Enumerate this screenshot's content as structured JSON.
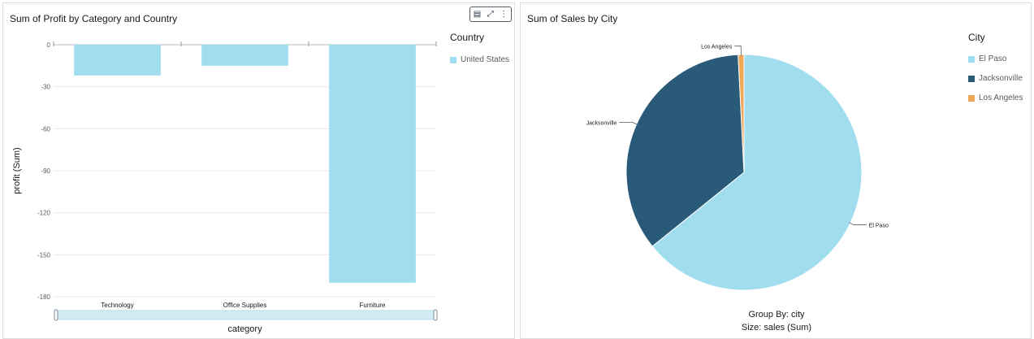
{
  "bar_panel": {
    "title": "Sum of Profit by Category and Country",
    "legend_title": "Country",
    "toolbar": {
      "visual_icon": "bar-chart-icon",
      "expand_icon": "expand-icon",
      "menu_icon": "more-vertical-icon"
    }
  },
  "pie_panel": {
    "title": "Sum of Sales by City",
    "legend_title": "City",
    "group_by_text": "Group By: city",
    "size_text": "Size: sales (Sum)"
  },
  "chart_data": [
    {
      "type": "bar",
      "title": "Sum of Profit by Category and Country",
      "xlabel": "category",
      "ylabel": "profit (Sum)",
      "categories": [
        "Technology",
        "Office Supplies",
        "Furniture"
      ],
      "series": [
        {
          "name": "United States",
          "values": [
            -22,
            -15,
            -170
          ],
          "color": "#a0ddee"
        }
      ],
      "yticks": [
        0,
        -30,
        -60,
        -90,
        -120,
        -150,
        -180
      ],
      "ylim": [
        -180,
        0
      ],
      "grid": true,
      "legend": "right"
    },
    {
      "type": "pie",
      "title": "Sum of Sales by City",
      "slices": [
        {
          "label": "El Paso",
          "value": 64.2,
          "color": "#a0ddee"
        },
        {
          "label": "Jacksonville",
          "value": 35.0,
          "color": "#295b78"
        },
        {
          "label": "Los Angeles",
          "value": 0.8,
          "color": "#f0a657"
        }
      ],
      "legend": "right"
    }
  ]
}
